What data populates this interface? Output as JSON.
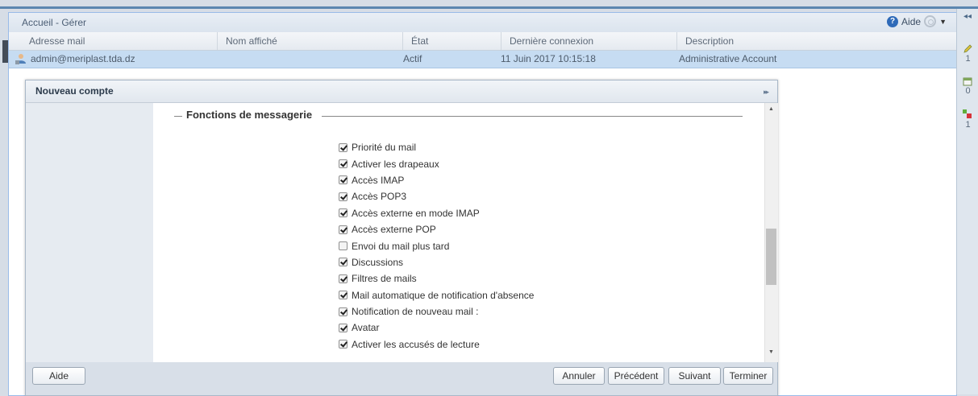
{
  "main_panel": {
    "title": "Accueil - Gérer",
    "help_label": "Aide",
    "columns": [
      "Adresse mail",
      "Nom affiché",
      "État",
      "Dernière connexion",
      "Description"
    ],
    "rows": [
      {
        "email": "admin@meriplast.tda.dz",
        "display_name": "",
        "state": "Actif",
        "last_login": "11 Juin 2017 10:15:18",
        "description": "Administrative Account"
      }
    ]
  },
  "right_strip": {
    "items": [
      {
        "icon": "pencil-icon",
        "count": "1"
      },
      {
        "icon": "calendar-icon",
        "count": "0"
      },
      {
        "icon": "task-icon",
        "count": "1"
      }
    ]
  },
  "dialog": {
    "title": "Nouveau compte",
    "section_title": "Fonctions de messagerie",
    "options": [
      {
        "label": "Priorité du mail",
        "checked": true
      },
      {
        "label": "Activer les drapeaux",
        "checked": true
      },
      {
        "label": "Accès IMAP",
        "checked": true
      },
      {
        "label": "Accès POP3",
        "checked": true
      },
      {
        "label": "Accès externe en mode IMAP",
        "checked": true
      },
      {
        "label": "Accès externe POP",
        "checked": true
      },
      {
        "label": "Envoi du mail plus tard",
        "checked": false
      },
      {
        "label": "Discussions",
        "checked": true
      },
      {
        "label": "Filtres de mails",
        "checked": true
      },
      {
        "label": "Mail automatique de notification d'absence",
        "checked": true
      },
      {
        "label": "Notification de nouveau mail :",
        "checked": true
      },
      {
        "label": "Avatar",
        "checked": true
      },
      {
        "label": "Activer les accusés de lecture",
        "checked": true
      }
    ],
    "buttons": {
      "help": "Aide",
      "cancel": "Annuler",
      "previous": "Précédent",
      "next": "Suivant",
      "finish": "Terminer"
    }
  }
}
